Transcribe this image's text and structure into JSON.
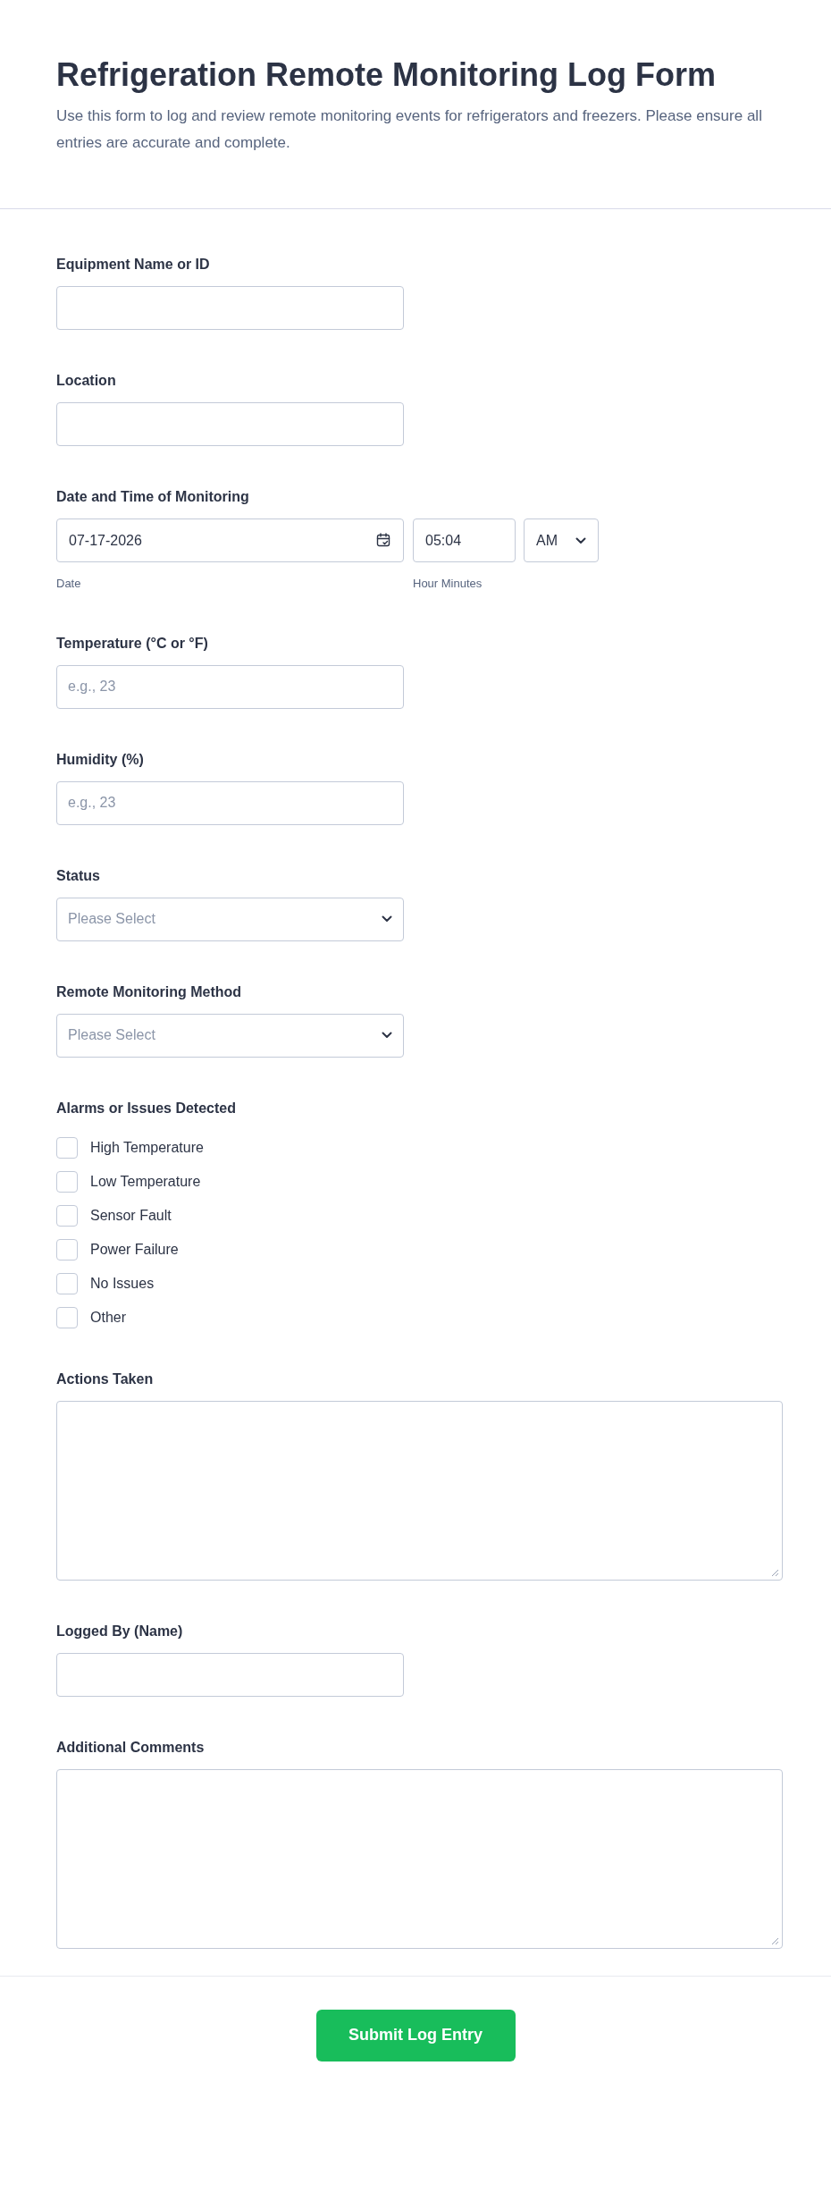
{
  "header": {
    "title": "Refrigeration Remote Monitoring Log Form",
    "description": "Use this form to log and review remote monitoring events for refrigerators and freezers. Please ensure all entries are accurate and complete."
  },
  "fields": [
    {
      "kind": "text",
      "label": "Equipment Name or ID"
    },
    {
      "kind": "text",
      "label": "Location"
    },
    {
      "kind": "datetime",
      "label": "Date and Time of Monitoring",
      "date": "07-17-2026",
      "date_caption": "Date",
      "time": "05:04",
      "time_caption": "Hour Minutes",
      "ampm": "AM"
    },
    {
      "kind": "text",
      "label": "Temperature (°C or °F)",
      "placeholder": "e.g., 23"
    },
    {
      "kind": "text",
      "label": "Humidity (%)",
      "placeholder": "e.g., 23"
    },
    {
      "kind": "select",
      "label": "Status",
      "placeholder": "Please Select"
    },
    {
      "kind": "select",
      "label": "Remote Monitoring Method",
      "placeholder": "Please Select"
    },
    {
      "kind": "checkboxes",
      "label": "Alarms or Issues Detected",
      "options": [
        {
          "label": "High Temperature",
          "checked": false
        },
        {
          "label": "Low Temperature",
          "checked": false
        },
        {
          "label": "Sensor Fault",
          "checked": false
        },
        {
          "label": "Power Failure",
          "checked": false
        },
        {
          "label": "No Issues",
          "checked": false
        },
        {
          "label": "Other",
          "checked": false
        }
      ]
    },
    {
      "kind": "textarea",
      "label": "Actions Taken"
    },
    {
      "kind": "text",
      "label": "Logged By (Name)"
    },
    {
      "kind": "textarea",
      "label": "Additional Comments"
    }
  ],
  "submit": "Submit Log Entry"
}
